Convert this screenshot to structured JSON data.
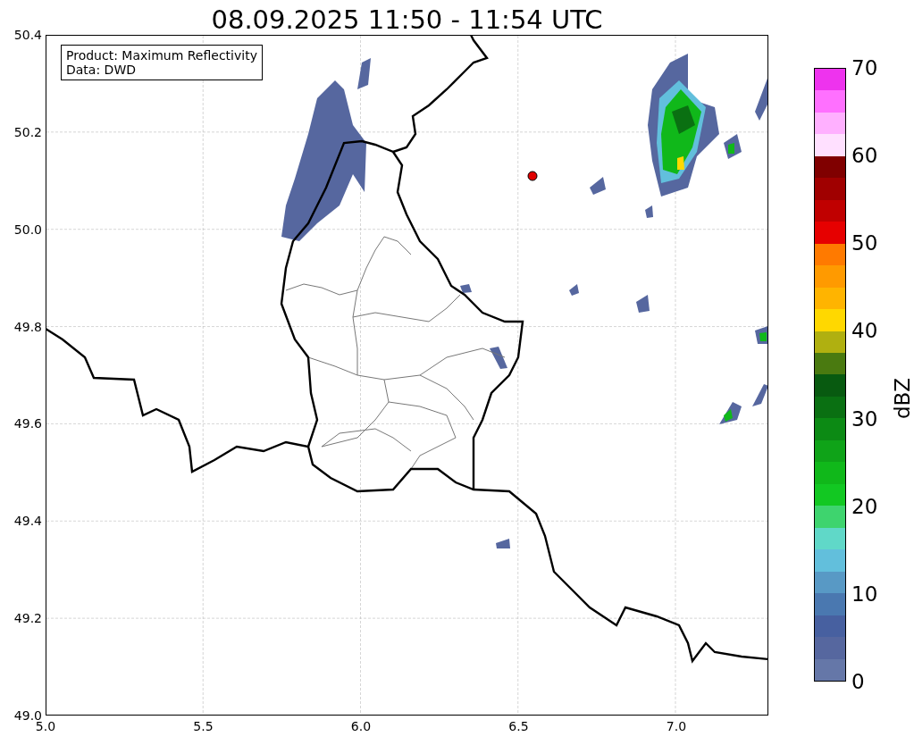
{
  "title": "08.09.2025 11:50 - 11:54 UTC",
  "info_box": {
    "lines": [
      "Product: Maximum Reflectivity",
      "Data: DWD"
    ]
  },
  "x_axis": {
    "ticks": [
      "5.0",
      "5.5",
      "6.0",
      "6.5",
      "7.0"
    ]
  },
  "y_axis": {
    "ticks": [
      "50.4",
      "50.2",
      "50.0",
      "49.8",
      "49.6",
      "49.4",
      "49.2",
      "49.0"
    ]
  },
  "colorbar": {
    "label": "dBZ",
    "ticks": [
      "70",
      "60",
      "50",
      "40",
      "30",
      "20",
      "10",
      "0"
    ],
    "bins": [
      {
        "color": "#6577a8"
      },
      {
        "color": "#56679f"
      },
      {
        "color": "#4760a0"
      },
      {
        "color": "#4a78b0"
      },
      {
        "color": "#5899c5"
      },
      {
        "color": "#62bfdc"
      },
      {
        "color": "#60d8c8"
      },
      {
        "color": "#3ed46e"
      },
      {
        "color": "#12c822"
      },
      {
        "color": "#10b81a"
      },
      {
        "color": "#0fa318"
      },
      {
        "color": "#0c8a14"
      },
      {
        "color": "#0a7012"
      },
      {
        "color": "#085a10"
      },
      {
        "color": "#4a7a10"
      },
      {
        "color": "#b0b010"
      },
      {
        "color": "#ffd800"
      },
      {
        "color": "#ffb400"
      },
      {
        "color": "#ff9a00"
      },
      {
        "color": "#ff7a00"
      },
      {
        "color": "#e60000"
      },
      {
        "color": "#c00000"
      },
      {
        "color": "#a00000"
      },
      {
        "color": "#800000"
      },
      {
        "color": "#ffe0ff"
      },
      {
        "color": "#ffb0ff"
      },
      {
        "color": "#ff70ff"
      },
      {
        "color": "#ee33ee"
      }
    ]
  }
}
